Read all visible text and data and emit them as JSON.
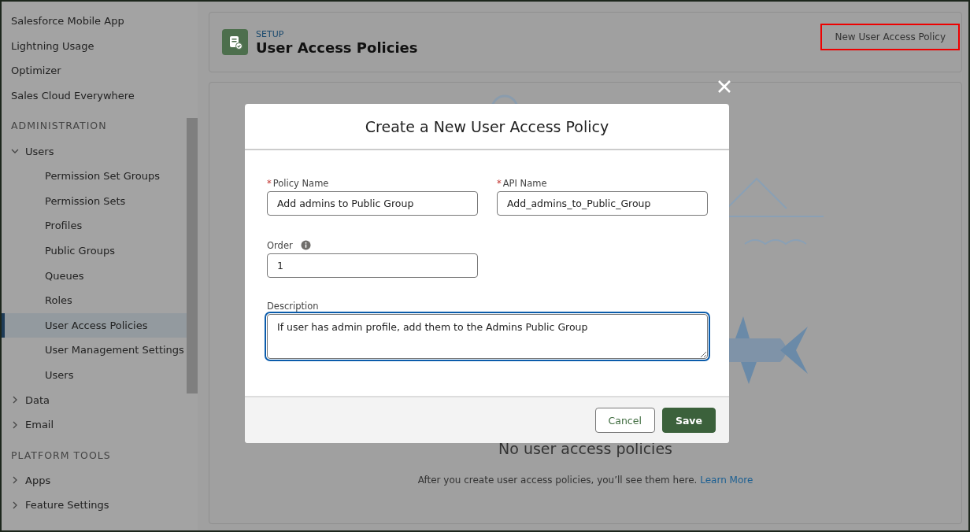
{
  "sidebar": {
    "items": [
      {
        "kind": "link",
        "label": "Salesforce Mobile App",
        "selected": false
      },
      {
        "kind": "link",
        "label": "Lightning Usage",
        "selected": false
      },
      {
        "kind": "link",
        "label": "Optimizer",
        "selected": false
      },
      {
        "kind": "link",
        "label": "Sales Cloud Everywhere",
        "selected": false
      },
      {
        "kind": "section",
        "label": "ADMINISTRATION"
      },
      {
        "kind": "group",
        "label": "Users",
        "expanded": true,
        "children": [
          {
            "label": "Permission Set Groups",
            "selected": false
          },
          {
            "label": "Permission Sets",
            "selected": false
          },
          {
            "label": "Profiles",
            "selected": false
          },
          {
            "label": "Public Groups",
            "selected": false
          },
          {
            "label": "Queues",
            "selected": false
          },
          {
            "label": "Roles",
            "selected": false
          },
          {
            "label": "User Access Policies",
            "selected": true
          },
          {
            "label": "User Management Settings",
            "selected": false
          },
          {
            "label": "Users",
            "selected": false
          }
        ]
      },
      {
        "kind": "group",
        "label": "Data",
        "expanded": false
      },
      {
        "kind": "group",
        "label": "Email",
        "expanded": false
      },
      {
        "kind": "section",
        "label": "PLATFORM TOOLS"
      },
      {
        "kind": "group",
        "label": "Apps",
        "expanded": false
      },
      {
        "kind": "group",
        "label": "Feature Settings",
        "expanded": false
      }
    ]
  },
  "header": {
    "eyebrow": "SETUP",
    "title": "User Access Policies",
    "action": "New User Access Policy"
  },
  "empty_state": {
    "title": "No user access policies",
    "text": "After you create user access policies, you’ll see them here.",
    "link": "Learn More"
  },
  "modal": {
    "title": "Create a New User Access Policy",
    "required_marker": "*",
    "fields": [
      {
        "kind": "input",
        "label": "Policy Name",
        "required": true,
        "value": "Add admins to Public Group",
        "info": false,
        "focused": false
      },
      {
        "kind": "input",
        "label": "API Name",
        "required": true,
        "value": "Add_admins_to_Public_Group",
        "info": false,
        "focused": false
      },
      {
        "kind": "input",
        "label": "Order",
        "required": false,
        "value": "1",
        "info": true,
        "focused": false
      },
      {
        "kind": "textarea",
        "label": "Description",
        "required": false,
        "value": "If user has admin profile, add them to the Admins Public Group",
        "info": false,
        "focused": true
      }
    ],
    "buttons": [
      {
        "label": "Cancel",
        "kind": "neutral"
      },
      {
        "label": "Save",
        "kind": "brand"
      }
    ]
  }
}
